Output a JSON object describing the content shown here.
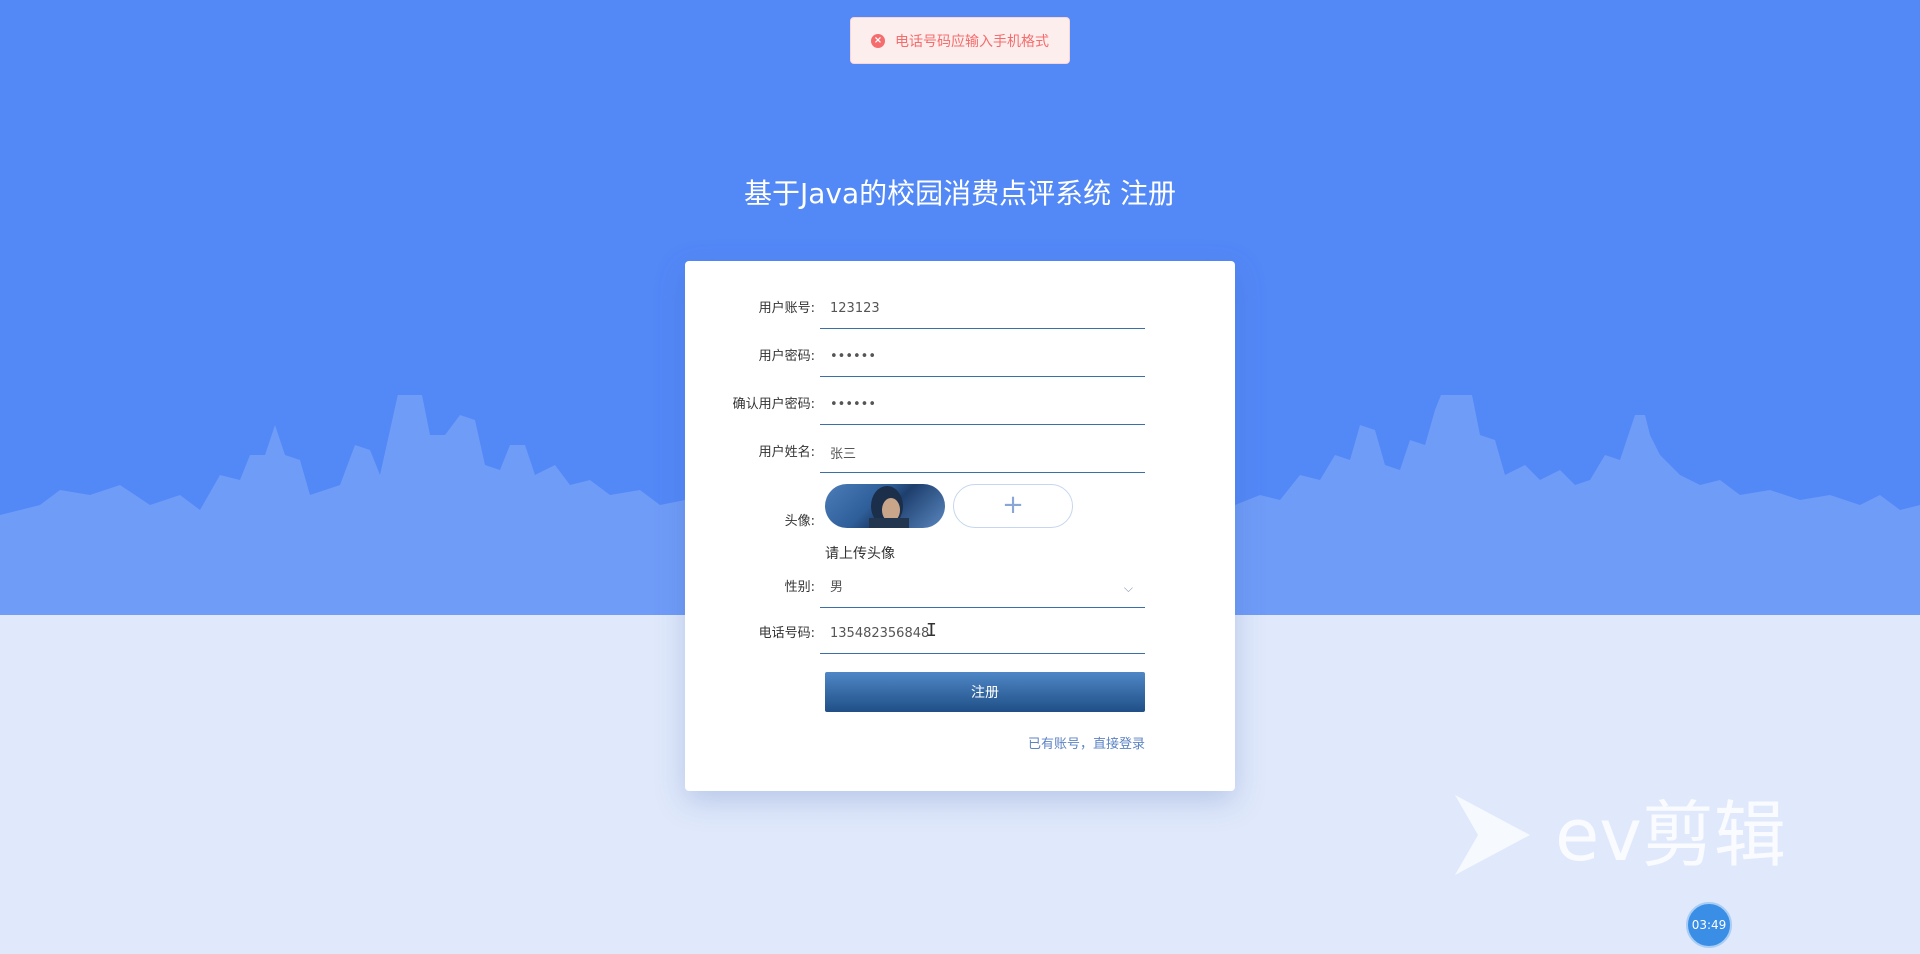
{
  "toast": {
    "message": "电话号码应输入手机格式",
    "icon": "error-circle-icon",
    "icon_glyph": "×"
  },
  "page_title": "基于Java的校园消费点评系统 注册",
  "form": {
    "account": {
      "label": "用户账号:",
      "value": "123123"
    },
    "password": {
      "label": "用户密码:",
      "value": "••••••"
    },
    "confirm_password": {
      "label": "确认用户密码:",
      "value": "••••••"
    },
    "name": {
      "label": "用户姓名:",
      "value": "张三"
    },
    "avatar": {
      "label": "头像:",
      "hint": "请上传头像",
      "upload_glyph": "+"
    },
    "gender": {
      "label": "性别:",
      "value": "男",
      "chevron": "⌵"
    },
    "phone": {
      "label": "电话号码:",
      "value": "135482356848"
    },
    "submit_label": "注册",
    "login_link": "已有账号，直接登录"
  },
  "watermark": {
    "text": "ev剪辑"
  },
  "timer": "03:49",
  "colors": {
    "sky": "#5388f7",
    "skyline": "#6f9cf7",
    "background": "#e0e9fb",
    "accent": "#1f4f86",
    "error": "#f56c6c"
  }
}
